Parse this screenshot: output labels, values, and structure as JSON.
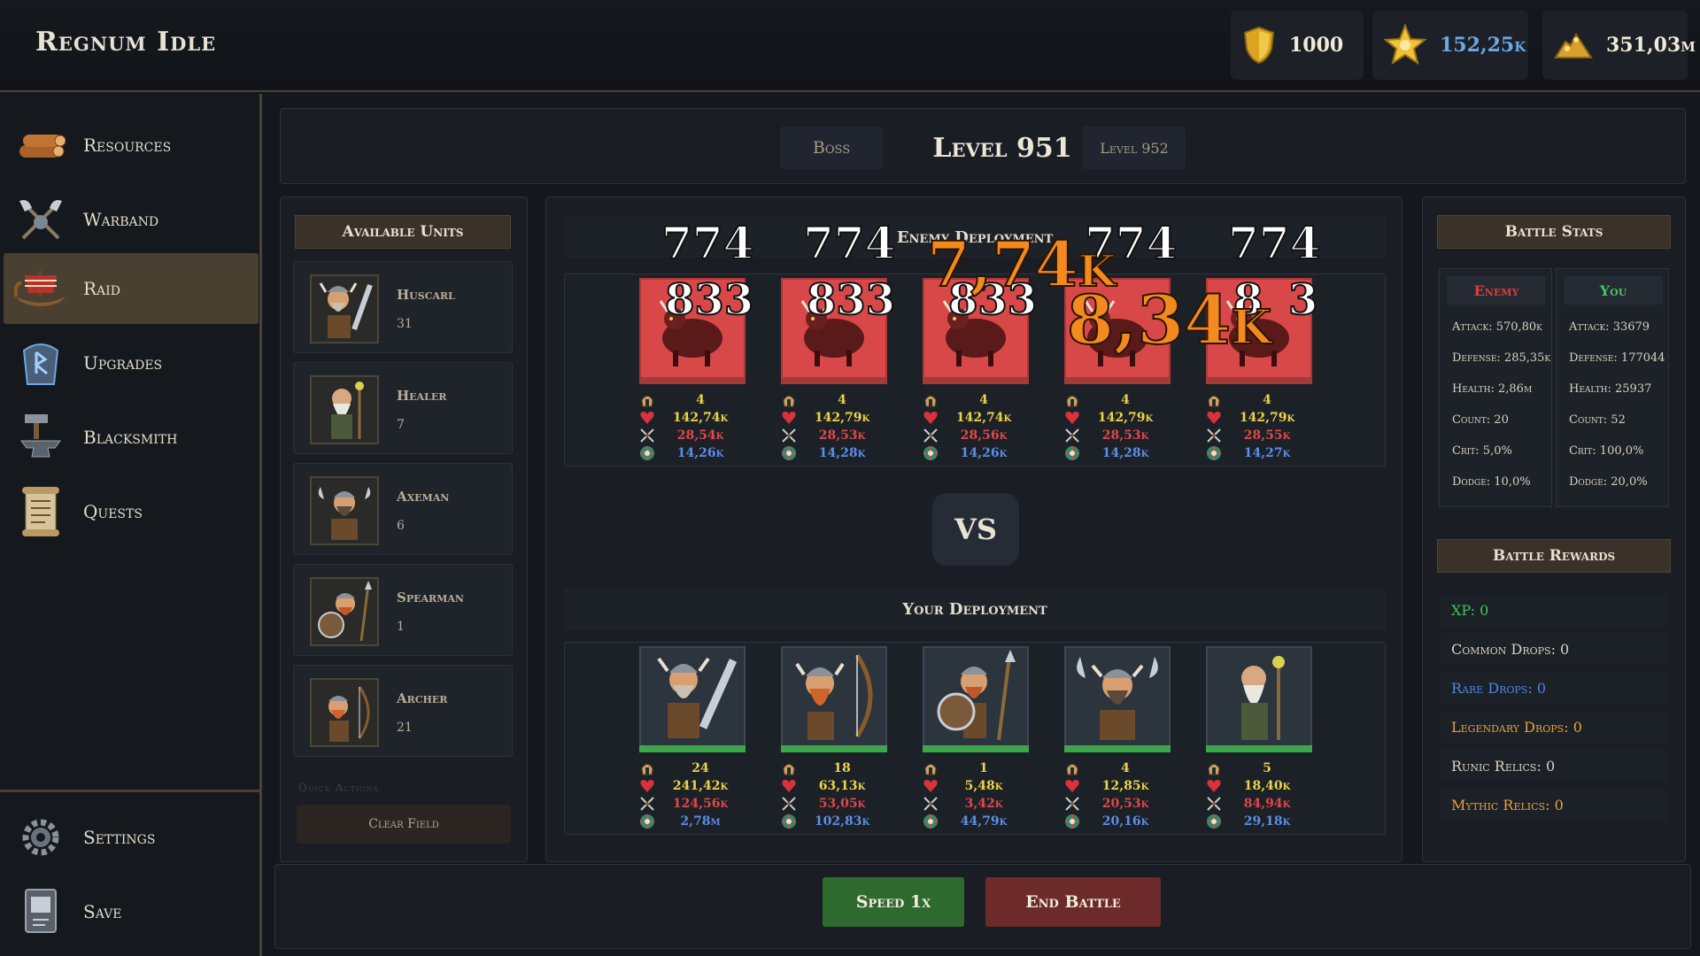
{
  "app": {
    "title": "Regnum Idle"
  },
  "resources": [
    {
      "name": "shield",
      "value": "1000"
    },
    {
      "name": "star",
      "value": "152,25k"
    },
    {
      "name": "gold",
      "value": "351,03m"
    }
  ],
  "sidebar": {
    "items": [
      {
        "label": "Resources",
        "icon": "wood-logs-icon"
      },
      {
        "label": "Warband",
        "icon": "crossed-axes-icon"
      },
      {
        "label": "Raid",
        "icon": "longship-icon"
      },
      {
        "label": "Upgrades",
        "icon": "rune-stone-icon"
      },
      {
        "label": "Blacksmith",
        "icon": "anvil-icon"
      },
      {
        "label": "Quests",
        "icon": "scroll-icon"
      }
    ],
    "bottom_items": [
      {
        "label": "Settings",
        "icon": "gear-icon"
      },
      {
        "label": "Save",
        "icon": "book-icon"
      }
    ]
  },
  "levels": {
    "boss_label": "Boss",
    "current": "Level 951",
    "next": "Level 952"
  },
  "available_units": {
    "title": "Available Units",
    "units": [
      {
        "name": "Huscarl",
        "count": "31"
      },
      {
        "name": "Healer",
        "count": "7"
      },
      {
        "name": "Axeman",
        "count": "6"
      },
      {
        "name": "Spearman",
        "count": "1"
      },
      {
        "name": "Archer",
        "count": "21"
      }
    ],
    "quick_actions_label": "Quick Actions",
    "clear_field": "Clear Field"
  },
  "enemy_deployment": {
    "title": "Enemy Deployment",
    "slots": [
      {
        "count": "4",
        "health": "142,74k",
        "attack": "28,54k",
        "defense": "14,26k"
      },
      {
        "count": "4",
        "health": "142,79k",
        "attack": "28,53k",
        "defense": "14,28k"
      },
      {
        "count": "4",
        "health": "142,74k",
        "attack": "28,56k",
        "defense": "14,26k"
      },
      {
        "count": "4",
        "health": "142,79k",
        "attack": "28,53k",
        "defense": "14,28k"
      },
      {
        "count": "4",
        "health": "142,79k",
        "attack": "28,55k",
        "defense": "14,27k"
      }
    ]
  },
  "vs_label": "VS",
  "your_deployment": {
    "title": "Your Deployment",
    "slots": [
      {
        "unit": "huscarl",
        "count": "24",
        "health": "241,42k",
        "attack": "124,56k",
        "defense": "2,78m"
      },
      {
        "unit": "archer",
        "count": "18",
        "health": "63,13k",
        "attack": "53,05k",
        "defense": "102,83k"
      },
      {
        "unit": "spearman",
        "count": "1",
        "health": "5,48k",
        "attack": "3,42k",
        "defense": "44,79k"
      },
      {
        "unit": "axeman",
        "count": "4",
        "health": "12,85k",
        "attack": "20,53k",
        "defense": "20,16k"
      },
      {
        "unit": "healer",
        "count": "5",
        "health": "18,40k",
        "attack": "84,94k",
        "defense": "29,18k"
      }
    ]
  },
  "damage_numbers": {
    "top": [
      "774",
      "774",
      "774",
      "774"
    ],
    "hits": [
      "833",
      "833",
      "833",
      "8",
      "3"
    ],
    "big": [
      "7,74k",
      "8,34k"
    ]
  },
  "battle_stats": {
    "title": "Battle Stats",
    "enemy": {
      "title": "Enemy",
      "attack": "Attack: 570,80k",
      "defense": "Defense: 285,35k",
      "health": "Health: 2,86m",
      "count": "Count: 20",
      "crit": "Crit: 5,0%",
      "dodge": "Dodge: 10,0%"
    },
    "you": {
      "title": "You",
      "attack": "Attack: 33679",
      "defense": "Defense: 177044",
      "health": "Health: 25937",
      "count": "Count: 52",
      "crit": "Crit: 100,0%",
      "dodge": "Dodge: 20,0%"
    }
  },
  "battle_rewards": {
    "title": "Battle Rewards",
    "xp": "XP: 0",
    "common": "Common Drops: 0",
    "rare": "Rare Drops: 0",
    "legendary": "Legendary Drops: 0",
    "runic": "Runic Relics: 0",
    "mythic": "Mythic Relics: 0"
  },
  "actions": {
    "speed": "Speed 1x",
    "end_battle": "End Battle"
  },
  "colors": {
    "accent_active": "#4a4032",
    "enemy_slot": "#d84848",
    "hp_green": "#3da64b",
    "xp_green": "#44c35a",
    "rare_blue": "#4d86e0",
    "legendary_orange": "#e8a03a",
    "mythic_orange": "#e8a03a",
    "enemy_red": "#e03b3b",
    "you_green": "#44c35a"
  }
}
